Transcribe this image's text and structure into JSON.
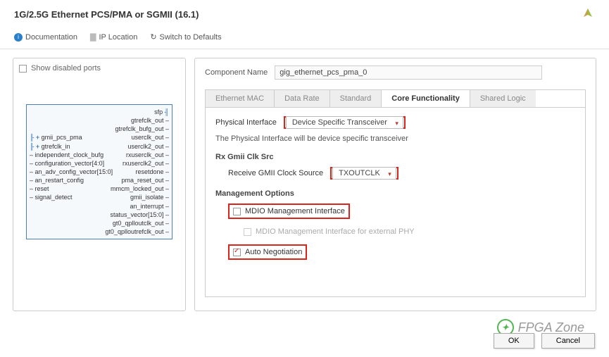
{
  "header": {
    "title": "1G/2.5G Ethernet PCS/PMA or SGMII (16.1)"
  },
  "toolbar": {
    "doc": "Documentation",
    "iploc": "IP Location",
    "switch": "Switch to Defaults"
  },
  "left": {
    "show_ports": "Show disabled ports",
    "ports_left": [
      "gmii_pcs_pma",
      "gtrefclk_in",
      "independent_clock_bufg",
      "configuration_vector[4:0]",
      "an_adv_config_vector[15:0]",
      "an_restart_config",
      "reset",
      "signal_detect"
    ],
    "ports_right": [
      "sfp",
      "gtrefclk_out",
      "gtrefclk_bufg_out",
      "userclk_out",
      "userclk2_out",
      "rxuserclk_out",
      "rxuserclk2_out",
      "resetdone",
      "pma_reset_out",
      "mmcm_locked_out",
      "gmii_isolate",
      "an_interrupt",
      "status_vector[15:0]",
      "gt0_qplloutclk_out",
      "gt0_qplloutrefclk_out"
    ]
  },
  "right": {
    "comp_label": "Component Name",
    "comp_value": "gig_ethernet_pcs_pma_0",
    "tabs": [
      "Ethernet MAC",
      "Data Rate",
      "Standard",
      "Core Functionality",
      "Shared Logic"
    ],
    "phy_label": "Physical Interface",
    "phy_value": "Device Specific Transceiver",
    "phy_hint": "The Physical Interface will be device specific transceiver",
    "rx_section": "Rx Gmii Clk Src",
    "rx_label": "Receive GMII Clock Source",
    "rx_value": "TXOUTCLK",
    "mgmt_section": "Management Options",
    "mdio": "MDIO Management Interface",
    "mdio_ext": "MDIO Management Interface for external PHY",
    "auto_neg": "Auto Negotiation"
  },
  "footer": {
    "ok": "OK",
    "cancel": "Cancel"
  },
  "watermark": "FPGA Zone"
}
